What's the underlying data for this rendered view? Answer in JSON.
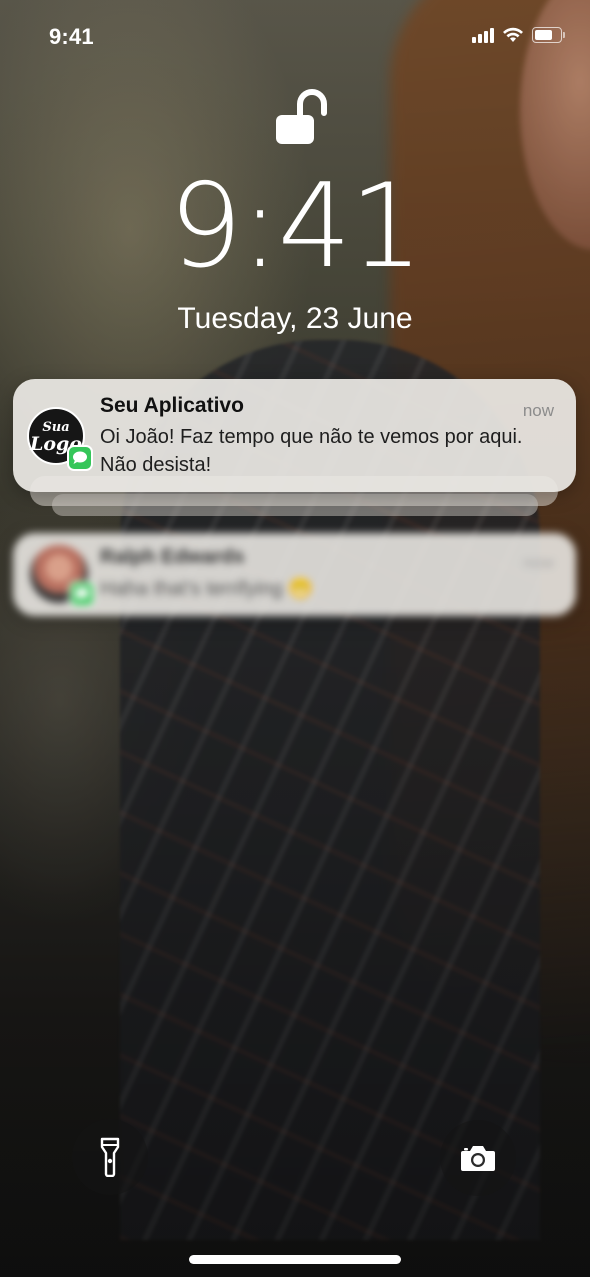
{
  "status_bar": {
    "time": "9:41",
    "battery_level": 0.75,
    "icons": [
      "cellular-signal-icon",
      "wifi-icon",
      "battery-icon"
    ]
  },
  "lock_screen": {
    "lock_state_icon": "unlocked-padlock-icon",
    "clock": "9:41",
    "date": "Tuesday,  23 June"
  },
  "notifications": [
    {
      "app_name": "Seu Aplicativo",
      "time": "now",
      "message": "Oi João! Faz tempo que não te vemos por aqui. Não desista!",
      "icon_text_line1": "Sua",
      "icon_text_line2": "Logo",
      "badge_icon": "messages-icon",
      "stacked": true
    },
    {
      "app_name": "Ralph Edwards",
      "time": "now",
      "message": "Haha that's terrifying 😬",
      "badge_icon": "messages-icon",
      "blurred": true
    }
  ],
  "bottom_controls": {
    "left": "flashlight-icon",
    "right": "camera-icon"
  },
  "colors": {
    "notification_bg": "#ebe8e4",
    "messages_green": "#35c659",
    "text_primary": "#111111",
    "text_secondary": "#8c8c8c"
  }
}
